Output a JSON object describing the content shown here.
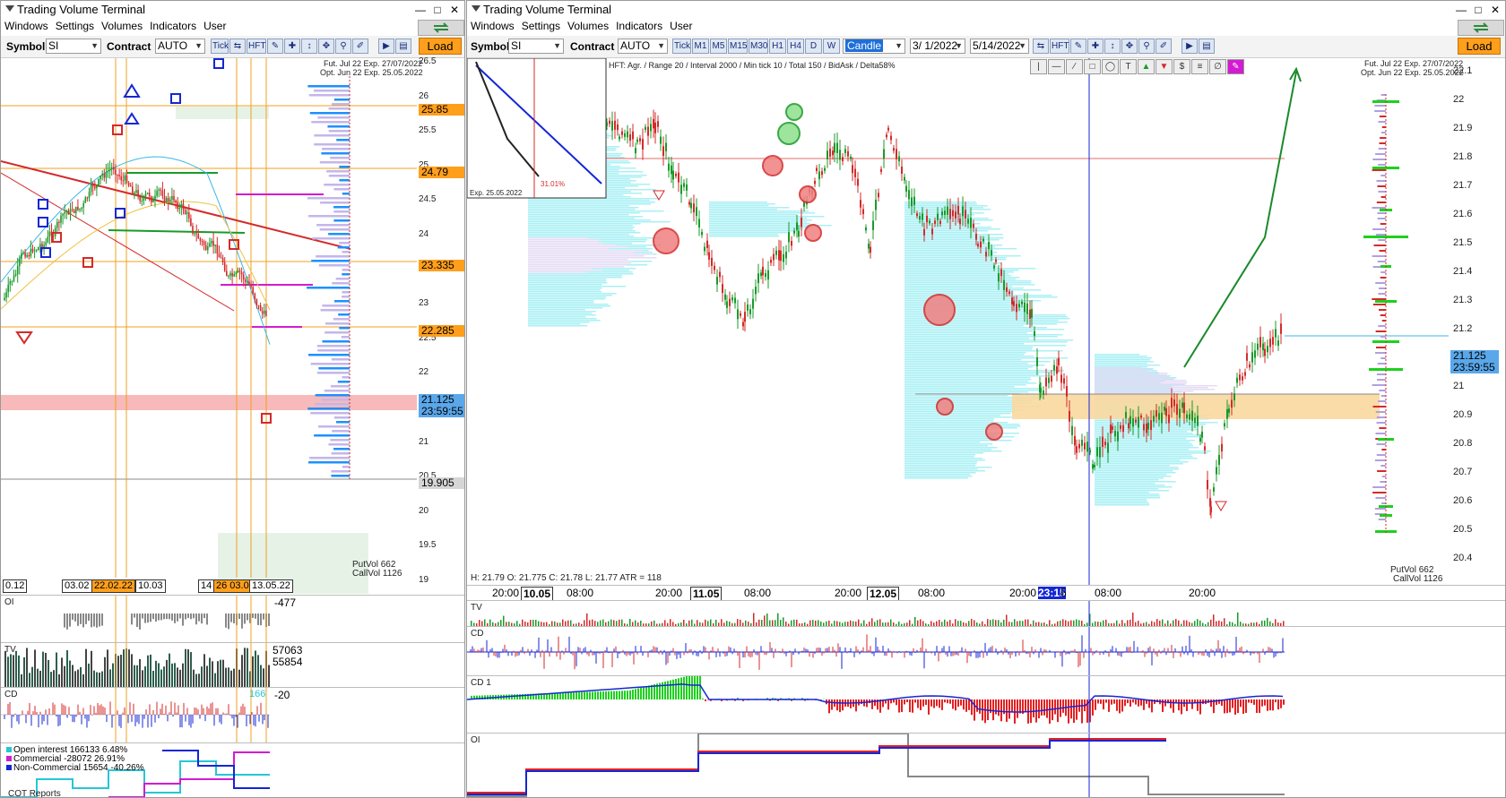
{
  "app": {
    "title": "Trading Volume Terminal"
  },
  "menu": [
    "Windows",
    "Settings",
    "Volumes",
    "Indicators",
    "User"
  ],
  "left": {
    "symbol_label": "Symbol",
    "symbol": "SI",
    "contract_label": "Contract",
    "contract": "AUTO",
    "buttons": [
      "Tick",
      "HFT"
    ],
    "load": "Load",
    "info_line1": "Fut. Jul 22 Exp. 27/07/2022",
    "info_line2": "Opt. Jun 22 Exp. 25.05.2022",
    "price_ticks": [
      "26.5",
      "26",
      "25.5",
      "25",
      "24.5",
      "24",
      "23.5",
      "23",
      "22.5",
      "22",
      "21.5",
      "21",
      "20.5",
      "20",
      "19.5",
      "19"
    ],
    "tags": [
      {
        "text": "25.85",
        "kind": "level"
      },
      {
        "text": "24.79",
        "kind": "level"
      },
      {
        "text": "23.335",
        "kind": "level"
      },
      {
        "text": "22.285",
        "kind": "level"
      },
      {
        "text": "21.125",
        "kind": "current"
      },
      {
        "text": "23:59:55",
        "kind": "current"
      },
      {
        "text": "19.905",
        "kind": "gray"
      }
    ],
    "put_vol": "PutVol  662",
    "call_vol": "CallVol  1126",
    "dates": [
      "0.12",
      "03.02",
      "22.02.22",
      "10.03",
      "14",
      "26 03.0",
      "13.05.22"
    ],
    "panes": {
      "oi": {
        "label": "OI",
        "value": "-477"
      },
      "tv": {
        "label": "TV",
        "value1": "57063",
        "value2": "55854"
      },
      "cd": {
        "label": "CD",
        "value": "-20",
        "inner": "166"
      }
    },
    "cot": {
      "rows": [
        {
          "name": "Open interest",
          "value": "166133",
          "pct": "6.48%",
          "color": "#27c6d6"
        },
        {
          "name": "Commercial",
          "value": "-28072",
          "pct": "26.91%",
          "color": "#d21bd2"
        },
        {
          "name": "Non-Commercial",
          "value": "15654",
          "pct": "-40.26%",
          "color": "#1426d6"
        }
      ],
      "title": "COT Reports"
    }
  },
  "right": {
    "symbol_label": "Symbol",
    "symbol": "SI",
    "contract_label": "Contract",
    "contract": "AUTO",
    "timeframes": [
      "Tick",
      "M1",
      "M5",
      "M15",
      "M30",
      "H1",
      "H4",
      "D",
      "W"
    ],
    "chart_type": "Candle",
    "date_from": "3/ 1/2022",
    "date_to": "5/14/2022",
    "hft": "HFT",
    "load": "Load",
    "header_info": "HFT: Agr. / Range 20 / Interval 2000 / Min tick 10 / Total 150 / BidAsk / Delta58%",
    "inset_label": "Exp. 25.05.2022",
    "inset_pct": "31.01%",
    "info_line1": "Fut. Jul 22 Exp. 27/07/2022",
    "info_line2": "Opt. Jun 22 Exp. 25.05.2022",
    "ohlc": "H: 21.79   O: 21.775   C: 21.78   L: 21.77   ATR = 118",
    "price_ticks": [
      "22.1",
      "22",
      "21.9",
      "21.8",
      "21.7",
      "21.6",
      "21.5",
      "21.4",
      "21.3",
      "21.2",
      "21.1",
      "21",
      "20.9",
      "20.8",
      "20.7",
      "20.6",
      "20.5",
      "20.4"
    ],
    "current_price": "21.125",
    "current_time": "23:59:55",
    "put_vol": "PutVol  662",
    "call_vol": "CallVol  1126",
    "time_labels": [
      "20:00",
      "10.05",
      "08:00",
      "20:00",
      "11.05",
      "08:00",
      "20:00",
      "12.05",
      "08:00",
      "20:00",
      "23:15",
      "5",
      "08:00",
      "20:00"
    ],
    "panes": {
      "tv": "TV",
      "cd": "CD",
      "cd1": "CD 1",
      "oi": "OI"
    }
  }
}
